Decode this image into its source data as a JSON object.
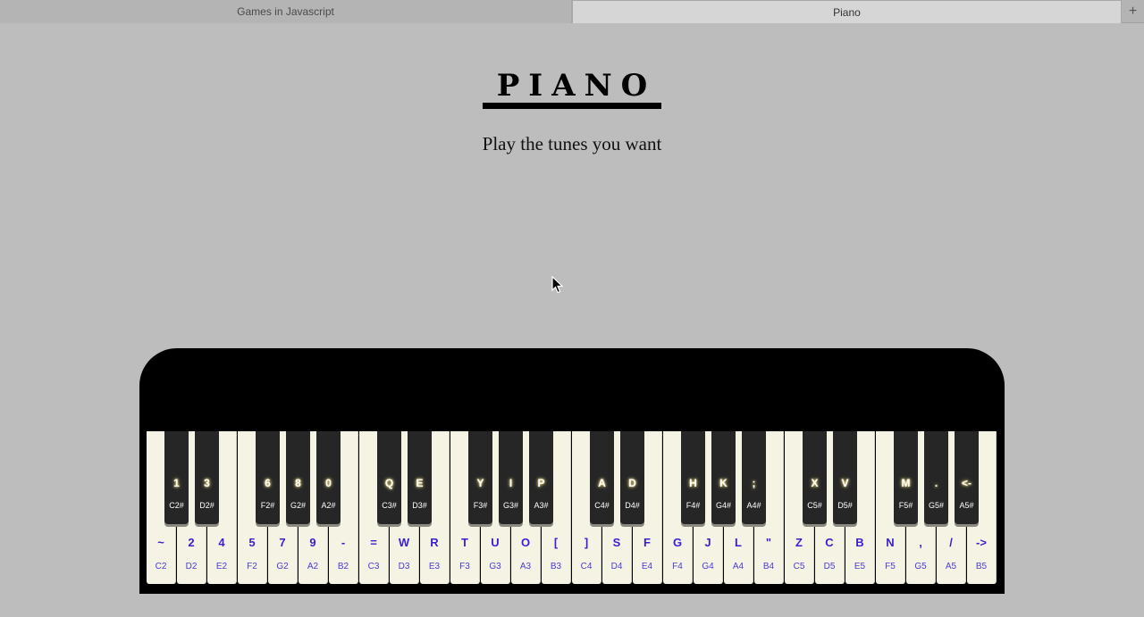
{
  "tabs": [
    {
      "label": "Games in Javascript"
    },
    {
      "label": "Piano"
    }
  ],
  "new_tab_label": "+",
  "page": {
    "title": "PIANO",
    "subtitle": "Play the tunes you want"
  },
  "white_keys": [
    {
      "key": "~",
      "note": "C2"
    },
    {
      "key": "2",
      "note": "D2"
    },
    {
      "key": "4",
      "note": "E2"
    },
    {
      "key": "5",
      "note": "F2"
    },
    {
      "key": "7",
      "note": "G2"
    },
    {
      "key": "9",
      "note": "A2"
    },
    {
      "key": "-",
      "note": "B2"
    },
    {
      "key": "=",
      "note": "C3"
    },
    {
      "key": "W",
      "note": "D3"
    },
    {
      "key": "R",
      "note": "E3"
    },
    {
      "key": "T",
      "note": "F3"
    },
    {
      "key": "U",
      "note": "G3"
    },
    {
      "key": "O",
      "note": "A3"
    },
    {
      "key": "[",
      "note": "B3"
    },
    {
      "key": "]",
      "note": "C4"
    },
    {
      "key": "S",
      "note": "D4"
    },
    {
      "key": "F",
      "note": "E4"
    },
    {
      "key": "G",
      "note": "F4"
    },
    {
      "key": "J",
      "note": "G4"
    },
    {
      "key": "L",
      "note": "A4"
    },
    {
      "key": "\"",
      "note": "B4"
    },
    {
      "key": "Z",
      "note": "C5"
    },
    {
      "key": "C",
      "note": "D5"
    },
    {
      "key": "B",
      "note": "E5"
    },
    {
      "key": "N",
      "note": "F5"
    },
    {
      "key": ",",
      "note": "G5"
    },
    {
      "key": "/",
      "note": "A5"
    },
    {
      "key": "->",
      "note": "B5"
    }
  ],
  "black_keys": [
    {
      "key": "1",
      "note": "C2#",
      "after": 0
    },
    {
      "key": "3",
      "note": "D2#",
      "after": 1
    },
    {
      "key": "6",
      "note": "F2#",
      "after": 3
    },
    {
      "key": "8",
      "note": "G2#",
      "after": 4
    },
    {
      "key": "0",
      "note": "A2#",
      "after": 5
    },
    {
      "key": "Q",
      "note": "C3#",
      "after": 7
    },
    {
      "key": "E",
      "note": "D3#",
      "after": 8
    },
    {
      "key": "Y",
      "note": "F3#",
      "after": 10
    },
    {
      "key": "I",
      "note": "G3#",
      "after": 11
    },
    {
      "key": "P",
      "note": "A3#",
      "after": 12
    },
    {
      "key": "A",
      "note": "C4#",
      "after": 14
    },
    {
      "key": "D",
      "note": "D4#",
      "after": 15
    },
    {
      "key": "H",
      "note": "F4#",
      "after": 17
    },
    {
      "key": "K",
      "note": "G4#",
      "after": 18
    },
    {
      "key": ";",
      "note": "A4#",
      "after": 19
    },
    {
      "key": "X",
      "note": "C5#",
      "after": 21
    },
    {
      "key": "V",
      "note": "D5#",
      "after": 22
    },
    {
      "key": "M",
      "note": "F5#",
      "after": 24
    },
    {
      "key": ".",
      "note": "G5#",
      "after": 25
    },
    {
      "key": "<-",
      "note": "A5#",
      "after": 26
    }
  ]
}
